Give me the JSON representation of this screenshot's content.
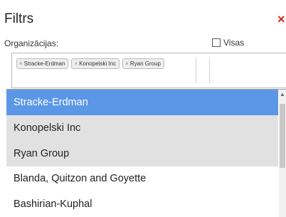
{
  "filter": {
    "title": "Filtrs",
    "close_glyph": "×",
    "org_label": "Organizācijas:",
    "all_label": "Visas",
    "selected_tags": [
      {
        "remove": "×",
        "label": "Stracke-Erdman"
      },
      {
        "remove": "×",
        "label": "Konopelski Inc"
      },
      {
        "remove": "×",
        "label": "Ryan Group"
      }
    ]
  },
  "dropdown": {
    "options": [
      {
        "label": "Stracke-Erdman",
        "state": "highlighted"
      },
      {
        "label": "Konopelski Inc",
        "state": "selected"
      },
      {
        "label": "Ryan Group",
        "state": "selected"
      },
      {
        "label": "Blanda, Quitzon and Goyette",
        "state": "normal"
      },
      {
        "label": "Bashirian-Kuphal",
        "state": "normal"
      }
    ]
  },
  "colors": {
    "highlight": "#5b97e6",
    "selected": "#e1e1e1",
    "close": "#dd2222"
  }
}
